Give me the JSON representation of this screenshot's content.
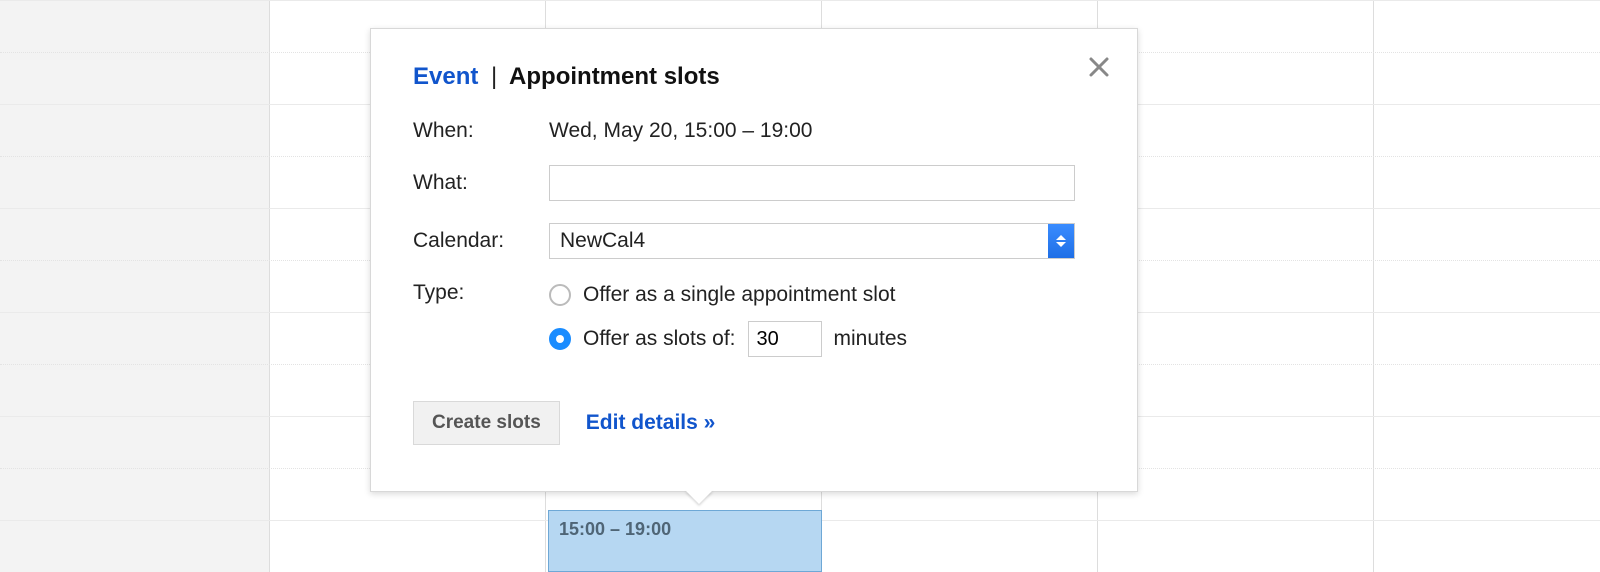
{
  "tabs": {
    "event": "Event",
    "separator": "|",
    "slots": "Appointment slots"
  },
  "labels": {
    "when": "When:",
    "what": "What:",
    "calendar": "Calendar:",
    "type": "Type:"
  },
  "when_value": "Wed, May 20, 15:00 – 19:00",
  "what_value": "",
  "calendar_selected": "NewCal4",
  "type_options": {
    "single": "Offer as a single appointment slot",
    "multi_prefix": "Offer as slots of:",
    "multi_suffix": "minutes",
    "duration_value": "30",
    "selected": "multi"
  },
  "actions": {
    "create": "Create slots",
    "edit": "Edit details »"
  },
  "event_block_label": "15:00 – 19:00"
}
